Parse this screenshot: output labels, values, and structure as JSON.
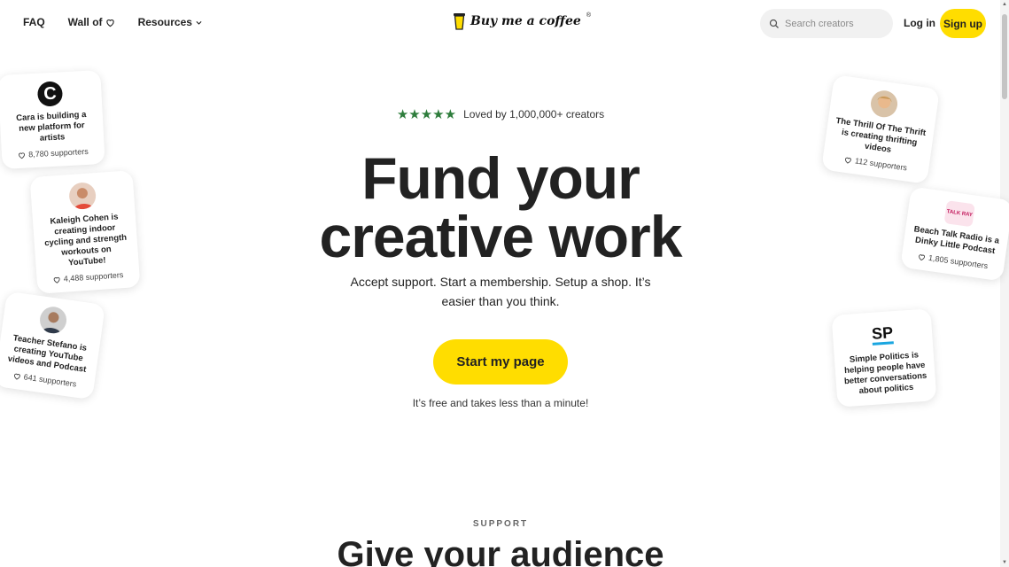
{
  "header": {
    "nav": [
      {
        "label": "FAQ"
      },
      {
        "label": "Wall of"
      },
      {
        "label": "Resources"
      }
    ],
    "logo_text": "Buy me a coffee",
    "logo_mark": "®",
    "search_placeholder": "Search creators",
    "login_label": "Log in",
    "signup_label": "Sign up"
  },
  "hero": {
    "stars": "★★★★★",
    "loved_text": "Loved by 1,000,000+ creators",
    "title_line1": "Fund your",
    "title_line2": "creative work",
    "subtitle": "Accept support. Start a membership. Setup a shop. It’s easier than you think.",
    "cta_label": "Start my page",
    "note": "It’s free and takes less than a minute!"
  },
  "cards": [
    {
      "desc": "Cara is building a new platform for artists",
      "supporters": "8,780 supporters",
      "avatar": "C"
    },
    {
      "desc": "Kaleigh Cohen is creating indoor cycling and strength workouts on YouTube!",
      "supporters": "4,488 supporters"
    },
    {
      "desc": "Teacher Stefano is creating YouTube videos and Podcast",
      "supporters": "641 supporters"
    },
    {
      "desc": "The Thrill Of The Thrift is creating thrifting videos",
      "supporters": "112 supporters"
    },
    {
      "desc": "Beach Talk Radio is a Dinky Little Podcast",
      "supporters": "1,805 supporters",
      "avatar": "TALK RAY"
    },
    {
      "desc": "Simple Politics is helping people have better conversations about politics",
      "avatar": "SP"
    }
  ],
  "section": {
    "label": "SUPPORT",
    "title": "Give your audience"
  },
  "colors": {
    "accent": "#ffdd00",
    "star": "#2e7d3c",
    "text": "#222222"
  }
}
